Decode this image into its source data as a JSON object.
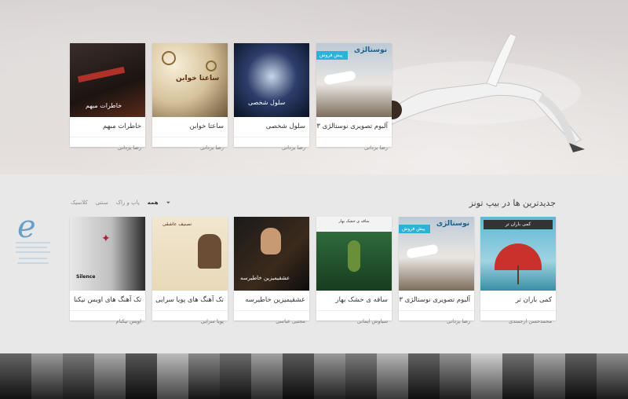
{
  "hero": {
    "cards": [
      {
        "title": "آلبوم تصویری نوستالژی ۳",
        "artist": "رضا یزدانی",
        "ribbon": "پیش فروش",
        "cover_text": "نوستالژی"
      },
      {
        "title": "سلول شخصی",
        "artist": "رضا یزدانی",
        "cover_text": "سلول شخصی"
      },
      {
        "title": "ساعتا خوابن",
        "artist": "رضا یزدانی",
        "cover_text": "ساعتا خوابن"
      },
      {
        "title": "خاطرات مبهم",
        "artist": "رضا یزدانی",
        "cover_text": "خاطرات مبهم"
      }
    ]
  },
  "new_section": {
    "title": "جدیدترین ها در بیپ تونز",
    "filters": [
      {
        "label": "همه",
        "active": true
      },
      {
        "label": "پاپ و راک",
        "active": false
      },
      {
        "label": "سنتی",
        "active": false
      },
      {
        "label": "کلاسیک",
        "active": false
      }
    ],
    "cards": [
      {
        "title": "کمی باران تر",
        "artist": "محمدحسن ارجمندی",
        "cover_text": "کمی باران تر"
      },
      {
        "title": "آلبوم تصویری نوستالژی ۳",
        "artist": "رضا یزدانی",
        "ribbon": "پیش فروش",
        "cover_text": "نوستالژی"
      },
      {
        "title": "ساقه ی خشک بهار",
        "artist": "سیاوش ایمانی",
        "cover_text": "ساقه ی خشک بهار"
      },
      {
        "title": "عشقیمیزین خاطیرسه",
        "artist": "مجتبی عباسی",
        "cover_text": "عشقیمیزین خاطیرسه"
      },
      {
        "title": "تک آهنگ های پویا سرایی",
        "artist": "پویا سرایی",
        "cover_text": "تصنیف عاشقی"
      },
      {
        "title": "تک آهنگ های اویس نیکنا",
        "artist": "اویس نیکنام",
        "cover_text": "Silence"
      }
    ]
  },
  "colors": {
    "accent": "#2bb2d6",
    "strip_bg": "#222222"
  }
}
